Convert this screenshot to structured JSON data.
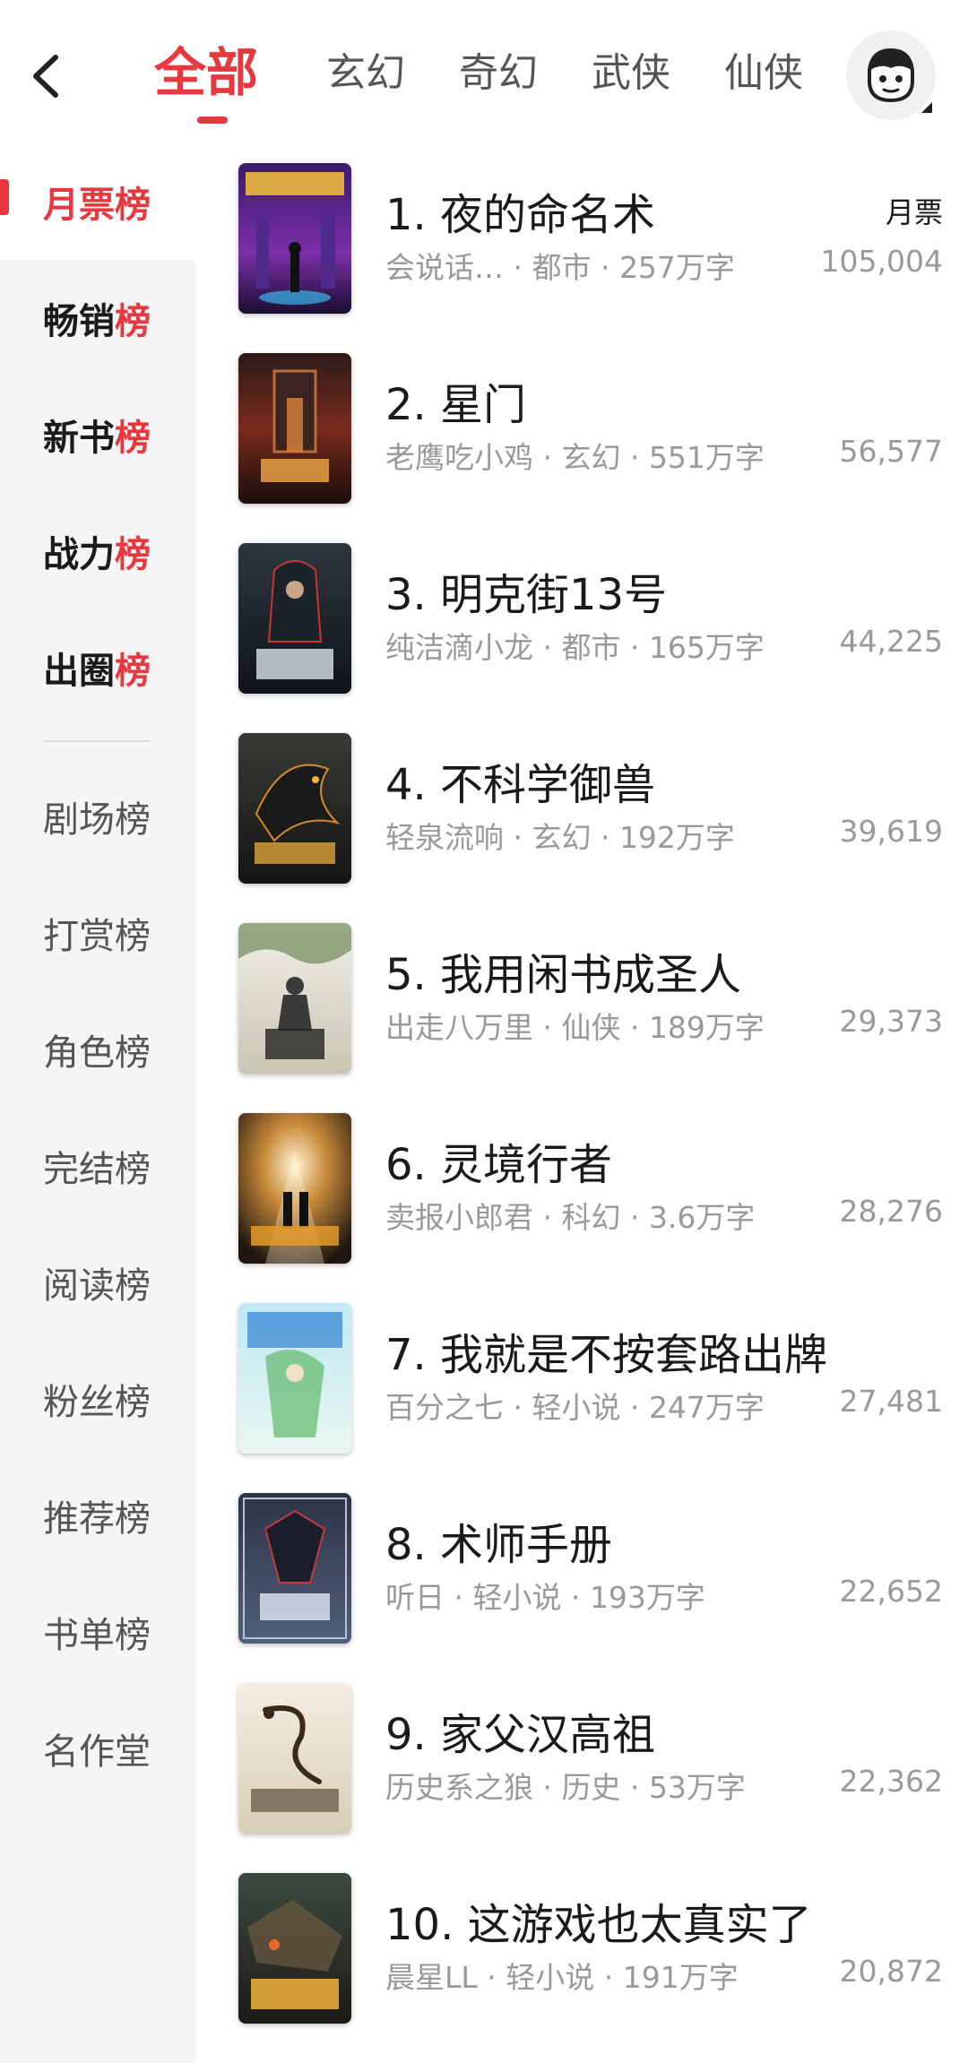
{
  "header": {
    "tabs": [
      {
        "label": "全部",
        "active": true
      },
      {
        "label": "玄幻",
        "active": false
      },
      {
        "label": "奇幻",
        "active": false
      },
      {
        "label": "武侠",
        "active": false
      },
      {
        "label": "仙侠",
        "active": false
      }
    ],
    "back_icon": "chevron-left-icon",
    "avatar_icon": "avatar-mascot-icon"
  },
  "sidebar": {
    "items": [
      {
        "label": "月票榜",
        "style": "active"
      },
      {
        "label": "畅销榜",
        "style": "bold"
      },
      {
        "label": "新书榜",
        "style": "bold"
      },
      {
        "label": "战力榜",
        "style": "bold"
      },
      {
        "label": "出圈榜",
        "style": "bold"
      },
      {
        "label": "剧场榜",
        "style": "normal"
      },
      {
        "label": "打赏榜",
        "style": "normal"
      },
      {
        "label": "角色榜",
        "style": "normal"
      },
      {
        "label": "完结榜",
        "style": "normal"
      },
      {
        "label": "阅读榜",
        "style": "normal"
      },
      {
        "label": "粉丝榜",
        "style": "normal"
      },
      {
        "label": "推荐榜",
        "style": "normal"
      },
      {
        "label": "书单榜",
        "style": "normal"
      },
      {
        "label": "名作堂",
        "style": "normal"
      }
    ]
  },
  "list": {
    "metric_label": "月票",
    "books": [
      {
        "title": "1. 夜的命名术",
        "meta": "会说话…  · 都市 · 257万字",
        "count": "105,004"
      },
      {
        "title": "2. 星门",
        "meta": "老鹰吃小鸡 · 玄幻 · 551万字",
        "count": "56,577"
      },
      {
        "title": "3. 明克街13号",
        "meta": "纯洁滴小龙 · 都市 · 165万字",
        "count": "44,225"
      },
      {
        "title": "4. 不科学御兽",
        "meta": "轻泉流响 · 玄幻 · 192万字",
        "count": "39,619"
      },
      {
        "title": "5. 我用闲书成圣人",
        "meta": "出走八万里 · 仙侠 · 189万字",
        "count": "29,373"
      },
      {
        "title": "6. 灵境行者",
        "meta": "卖报小郎君 · 科幻 · 3.6万字",
        "count": "28,276"
      },
      {
        "title": "7. 我就是不按套路出牌",
        "meta": "百分之七 · 轻小说 · 247万字",
        "count": "27,481"
      },
      {
        "title": "8. 术师手册",
        "meta": "听日 · 轻小说 · 193万字",
        "count": "22,652"
      },
      {
        "title": "9. 家父汉高祖",
        "meta": "历史系之狼 · 历史 · 53万字",
        "count": "22,362"
      },
      {
        "title": "10. 这游戏也太真实了",
        "meta": "晨星LL · 轻小说 · 191万字",
        "count": "20,872"
      }
    ]
  },
  "colors": {
    "accent": "#e8373e",
    "sidebar_bg": "#f5f5f5",
    "meta_text": "#999999"
  }
}
